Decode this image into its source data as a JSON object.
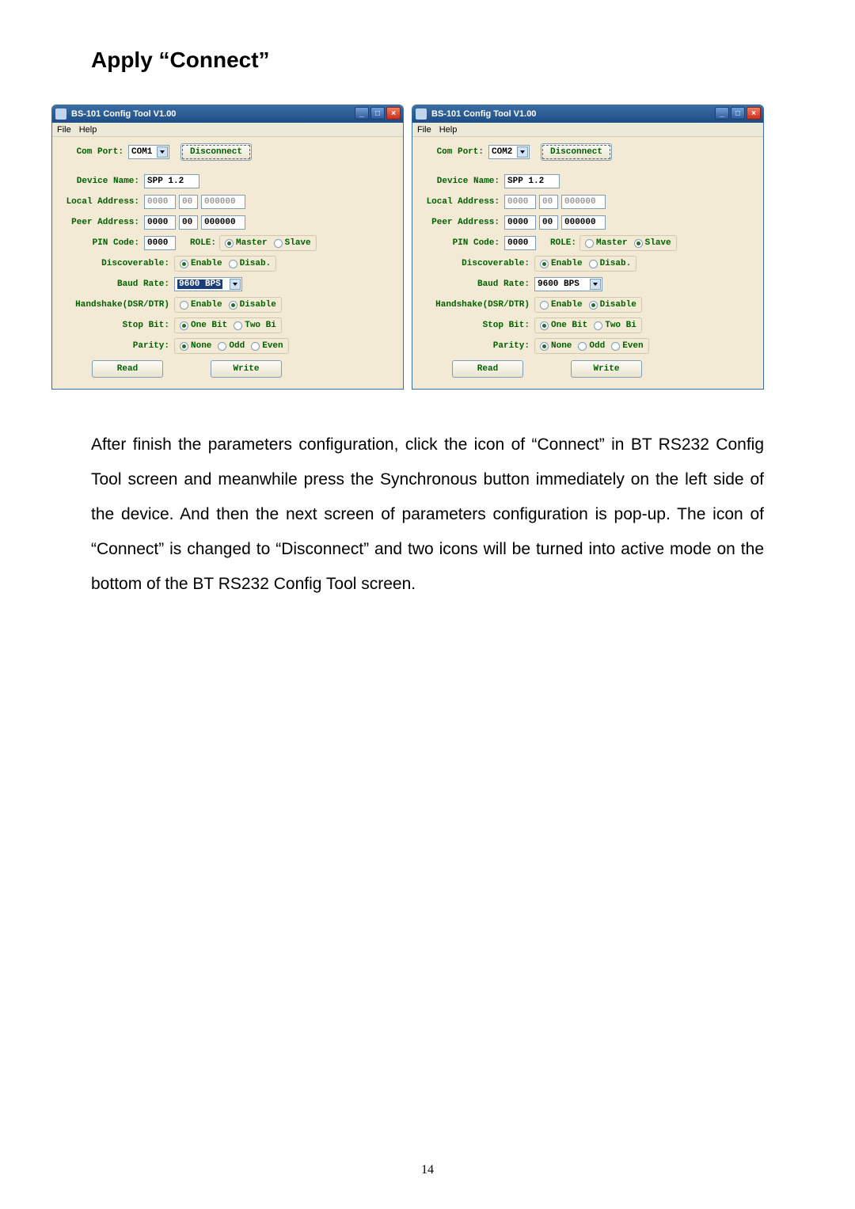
{
  "section_title": "Apply “Connect”",
  "body_paragraph": "After finish the parameters configuration, click the icon of “Connect” in BT RS232 Config Tool screen and meanwhile press the Synchronous button immediately on the left side of the device. And then the next screen of parameters configuration is pop-up. The icon of “Connect” is changed to “Disconnect” and two icons will be turned into active mode on the bottom of the BT RS232 Config Tool screen.",
  "page_number": "14",
  "windows": {
    "left": {
      "title": "BS-101 Config Tool V1.00",
      "menu": {
        "file": "File",
        "help": "Help"
      },
      "labels": {
        "com_port": "Com Port:",
        "device_name": "Device Name:",
        "local_address": "Local Address:",
        "peer_address": "Peer Address:",
        "pin_code": "PIN Code:",
        "role": "ROLE:",
        "discoverable": "Discoverable:",
        "baud_rate": "Baud Rate:",
        "handshake": "Handshake(DSR/DTR)",
        "stop_bit": "Stop Bit:",
        "parity": "Parity:"
      },
      "values": {
        "com_port": "COM1",
        "device_name": "SPP 1.2",
        "local_addr1": "0000",
        "local_addr2": "00",
        "local_addr3": "000000",
        "peer_addr1": "0000",
        "peer_addr2": "00",
        "peer_addr3": "000000",
        "pin_code": "0000",
        "baud_rate": "9600 BPS"
      },
      "radios": {
        "role_master": "Master",
        "role_slave": "Slave",
        "role_selected": "master",
        "disc_enable": "Enable",
        "disc_disable": "Disab.",
        "disc_selected": "enable",
        "hs_enable": "Enable",
        "hs_disable": "Disable",
        "hs_selected": "disable",
        "sb_one": "One Bit",
        "sb_two": "Two Bi",
        "sb_selected": "one",
        "par_none": "None",
        "par_odd": "Odd",
        "par_even": "Even",
        "par_selected": "none"
      },
      "buttons": {
        "disconnect": "Disconnect",
        "read": "Read",
        "write": "Write"
      }
    },
    "right": {
      "title": "BS-101 Config Tool V1.00",
      "menu": {
        "file": "File",
        "help": "Help"
      },
      "labels": {
        "com_port": "Com Port:",
        "device_name": "Device Name:",
        "local_address": "Local Address:",
        "peer_address": "Peer Address:",
        "pin_code": "PIN Code:",
        "role": "ROLE:",
        "discoverable": "Discoverable:",
        "baud_rate": "Baud Rate:",
        "handshake": "Handshake(DSR/DTR)",
        "stop_bit": "Stop Bit:",
        "parity": "Parity:"
      },
      "values": {
        "com_port": "COM2",
        "device_name": "SPP 1.2",
        "local_addr1": "0000",
        "local_addr2": "00",
        "local_addr3": "000000",
        "peer_addr1": "0000",
        "peer_addr2": "00",
        "peer_addr3": "000000",
        "pin_code": "0000",
        "baud_rate": "9600 BPS"
      },
      "radios": {
        "role_master": "Master",
        "role_slave": "Slave",
        "role_selected": "slave",
        "disc_enable": "Enable",
        "disc_disable": "Disab.",
        "disc_selected": "enable",
        "hs_enable": "Enable",
        "hs_disable": "Disable",
        "hs_selected": "disable",
        "sb_one": "One Bit",
        "sb_two": "Two Bi",
        "sb_selected": "one",
        "par_none": "None",
        "par_odd": "Odd",
        "par_even": "Even",
        "par_selected": "none"
      },
      "buttons": {
        "disconnect": "Disconnect",
        "read": "Read",
        "write": "Write"
      }
    }
  }
}
